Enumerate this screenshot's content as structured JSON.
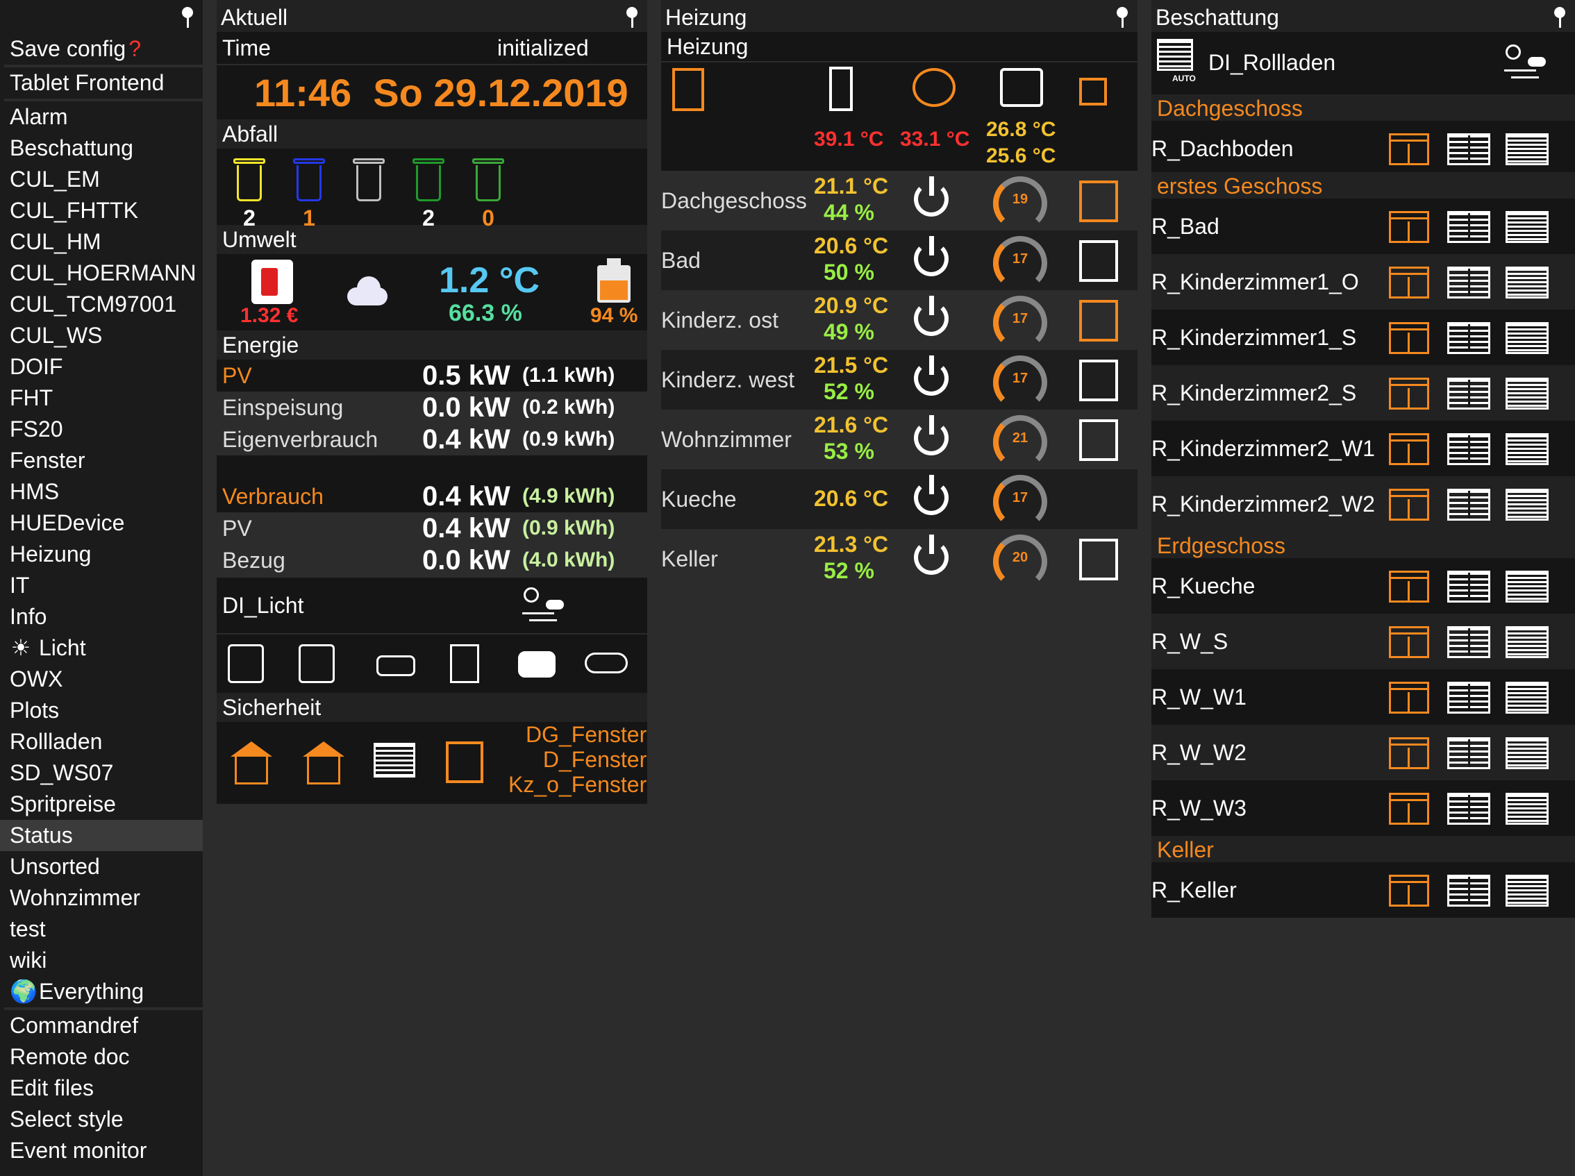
{
  "sidebar": {
    "save_config": "Save config",
    "save_marker": "?",
    "tablet_frontend": "Tablet Frontend",
    "rooms": [
      "Alarm",
      "Beschattung",
      "CUL_EM",
      "CUL_FHTTK",
      "CUL_HM",
      "CUL_HOERMANN",
      "CUL_TCM97001",
      "CUL_WS",
      "DOIF",
      "FHT",
      "FS20",
      "Fenster",
      "HMS",
      "HUEDevice",
      "Heizung",
      "IT",
      "Info",
      "Licht",
      "OWX",
      "Plots",
      "Rollladen",
      "SD_WS07",
      "Spritpreise",
      "Status",
      "Unsorted",
      "Wohnzimmer",
      "test",
      "wiki",
      "Everything"
    ],
    "tools": [
      "Commandref",
      "Remote doc",
      "Edit files",
      "Select style",
      "Event monitor"
    ]
  },
  "aktuell": {
    "title": "Aktuell",
    "time_label": "Time",
    "time_status": "initialized",
    "clock": "11:46  So 29.12.2019",
    "abfall_label": "Abfall",
    "bins": [
      {
        "count": "2",
        "color": "#f2e52a"
      },
      {
        "count": "1",
        "color": "#2438e8"
      },
      {
        "count": "",
        "color": "#bfbfbf"
      },
      {
        "count": "2",
        "color": "#1f9a2b"
      },
      {
        "count": "0",
        "color": "#3aa838"
      }
    ],
    "umwelt_label": "Umwelt",
    "fuel_price": "1.32 €",
    "outside_temp": "1.2 °C",
    "outside_hum": "66.3 %",
    "tank_level": "94 %",
    "energie_label": "Energie",
    "energy": [
      {
        "label": "PV",
        "value": "0.5 kW",
        "sub": "(1.1 kWh)"
      },
      {
        "label": "Einspeisung",
        "value": "0.0 kW",
        "sub": "(0.2 kWh)"
      },
      {
        "label": "Eigenverbrauch",
        "value": "0.4 kW",
        "sub": "(0.9 kWh)"
      }
    ],
    "consumption": [
      {
        "label": "Verbrauch",
        "value": "0.4 kW",
        "sub": "(4.9 kWh)"
      },
      {
        "label": "PV",
        "value": "0.4 kW",
        "sub": "(0.9 kWh)"
      },
      {
        "label": "Bezug",
        "value": "0.0 kW",
        "sub": "(4.0 kWh)"
      }
    ],
    "di_licht": "DI_Licht",
    "sicherheit_label": "Sicherheit",
    "fenster": [
      "DG_Fenster",
      "D_Fenster",
      "Kz_o_Fenster"
    ]
  },
  "heizung": {
    "title": "Heizung",
    "subtitle": "Heizung",
    "temps": {
      "t1": "39.1 °C",
      "t2": "33.1 °C",
      "t3": "26.8 °C",
      "t4": "25.6 °C"
    },
    "rooms": [
      {
        "name": "Dachgeschoss",
        "temp": "21.1 °C",
        "hum": "44 %",
        "set": "19",
        "window_open": true
      },
      {
        "name": "Bad",
        "temp": "20.6 °C",
        "hum": "50 %",
        "set": "17",
        "window_open": false
      },
      {
        "name": "Kinderz. ost",
        "temp": "20.9 °C",
        "hum": "49 %",
        "set": "17",
        "window_open": true
      },
      {
        "name": "Kinderz. west",
        "temp": "21.5 °C",
        "hum": "52 %",
        "set": "17",
        "window_open": false
      },
      {
        "name": "Wohnzimmer",
        "temp": "21.6 °C",
        "hum": "53 %",
        "set": "21",
        "window_open": false
      },
      {
        "name": "Kueche",
        "temp": "20.6 °C",
        "hum": "",
        "set": "17",
        "window_open": null
      },
      {
        "name": "Keller",
        "temp": "21.3 °C",
        "hum": "52 %",
        "set": "20",
        "window_open": false
      }
    ]
  },
  "beschattung": {
    "title": "Beschattung",
    "device": "DI_Rollladen",
    "auto_label": "AUTO",
    "floors": [
      {
        "name": "Dachgeschoss",
        "rows": [
          "R_Dachboden"
        ]
      },
      {
        "name": "erstes Geschoss",
        "rows": [
          "R_Bad",
          "R_Kinderzimmer1_O",
          "R_Kinderzimmer1_S",
          "R_Kinderzimmer2_S",
          "R_Kinderzimmer2_W1",
          "R_Kinderzimmer2_W2"
        ]
      },
      {
        "name": "Erdgeschoss",
        "rows": [
          "R_Kueche",
          "R_W_S",
          "R_W_W1",
          "R_W_W2",
          "R_W_W3"
        ]
      },
      {
        "name": "Keller",
        "rows": [
          "R_Keller"
        ]
      }
    ]
  },
  "colors": {
    "accent": "#f5891f",
    "temp": "#f2c230",
    "humidity": "#99ee44",
    "outside": "#56c8f2",
    "alert": "#ff3030"
  }
}
